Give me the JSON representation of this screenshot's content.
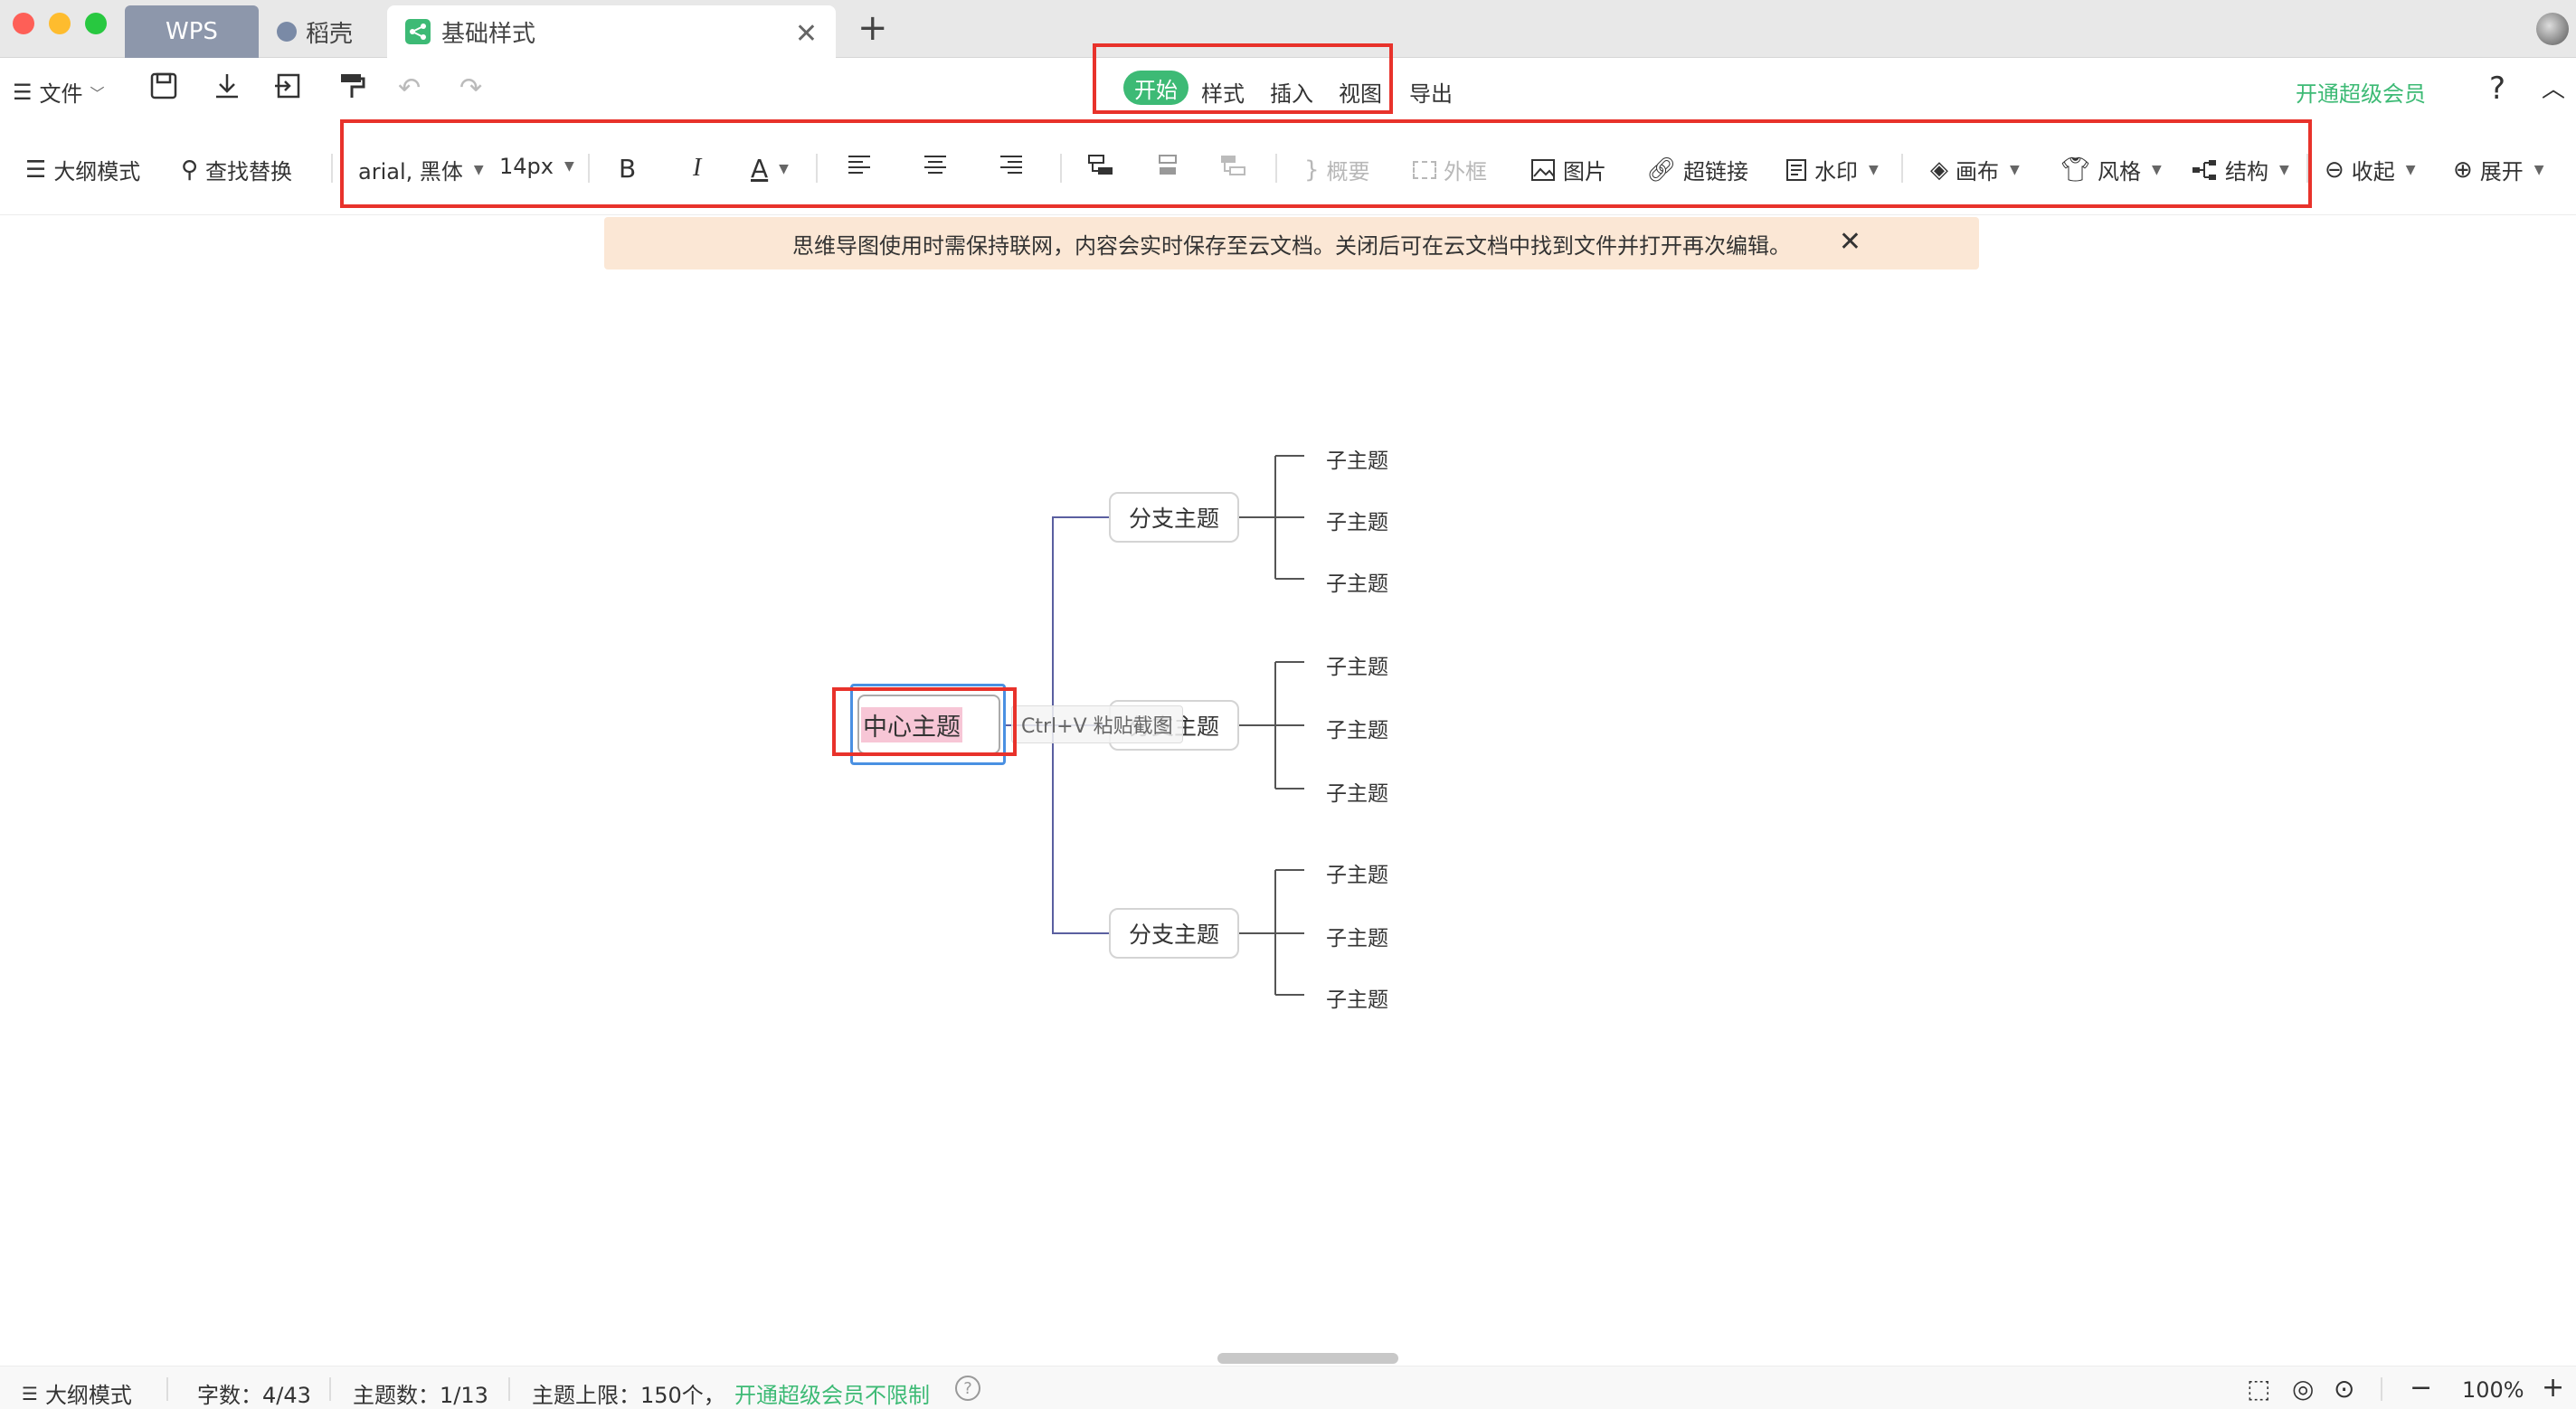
{
  "window": {
    "tabs": [
      {
        "label": "WPS"
      },
      {
        "label": "稻壳"
      },
      {
        "label": "基础样式"
      }
    ],
    "new_tab": "+"
  },
  "menubar": {
    "file_label": "文件",
    "menu_tabs": [
      "开始",
      "样式",
      "插入",
      "视图",
      "导出"
    ],
    "vip_label": "开通超级会员",
    "help_label": "?"
  },
  "toolbar": {
    "outline_mode": "大纲模式",
    "find_replace": "查找替换",
    "font_family": "arial, 黑体",
    "font_size": "14px",
    "bold": "B",
    "italic": "I",
    "font_color": "A",
    "summary": "概要",
    "frame": "外框",
    "image": "图片",
    "hyperlink": "超链接",
    "watermark": "水印",
    "canvas": "画布",
    "style": "风格",
    "structure": "结构",
    "collapse": "收起",
    "expand": "展开"
  },
  "notice": {
    "text": "思维导图使用时需保持联网，内容会实时保存至云文档。关闭后可在云文档中找到文件并打开再次编辑。"
  },
  "mindmap": {
    "central_topic": "中心主题",
    "paste_hint": "Ctrl+V 粘贴截图",
    "branches": [
      {
        "label": "分支主题",
        "children": [
          "子主题",
          "子主题",
          "子主题"
        ]
      },
      {
        "label": "分支主题",
        "children": [
          "子主题",
          "子主题",
          "子主题"
        ]
      },
      {
        "label": "分支主题",
        "children": [
          "子主题",
          "子主题",
          "子主题"
        ]
      }
    ]
  },
  "status": {
    "outline_mode": "大纲模式",
    "word_count": "字数：4/43",
    "topic_count": "主题数：1/13",
    "topic_limit": "主题上限：150个，",
    "vip_unlimited": "开通超级会员不限制",
    "zoom": "100%",
    "zoom_minus": "−",
    "zoom_plus": "+"
  },
  "colors": {
    "accent_green": "#3dba75",
    "highlight_red": "#e8322b",
    "selection_blue": "#4a90e2",
    "notice_bg": "#fbe7d5"
  }
}
